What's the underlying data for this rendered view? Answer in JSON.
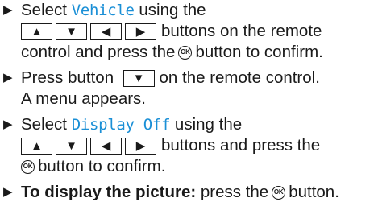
{
  "accent_color": "#1a8fd6",
  "icons": {
    "bullet": "triangle-right-icon",
    "up": "arrow-up-icon",
    "down": "arrow-down-icon",
    "left": "arrow-left-icon",
    "right": "arrow-right-icon",
    "ok": "ok-button-icon"
  },
  "glyphs": {
    "bullet": "▶",
    "up": "▲",
    "down": "▼",
    "left": "◀",
    "right": "▶",
    "ok": "OK"
  },
  "steps": [
    {
      "select": "Select",
      "item": "Vehicle",
      "using": "using the",
      "after_keys": "buttons on the remote",
      "line3": "control and press the",
      "after_ok": "button to confirm."
    },
    {
      "press": "Press button",
      "after_key": "on the remote control.",
      "line2": "A menu appears."
    },
    {
      "select": "Select",
      "item": "Display Off",
      "using": "using the",
      "after_keys": "buttons and press the",
      "after_ok": "button to confirm."
    },
    {
      "bold": "To display the picture:",
      "press": "press the",
      "end": "button."
    }
  ]
}
